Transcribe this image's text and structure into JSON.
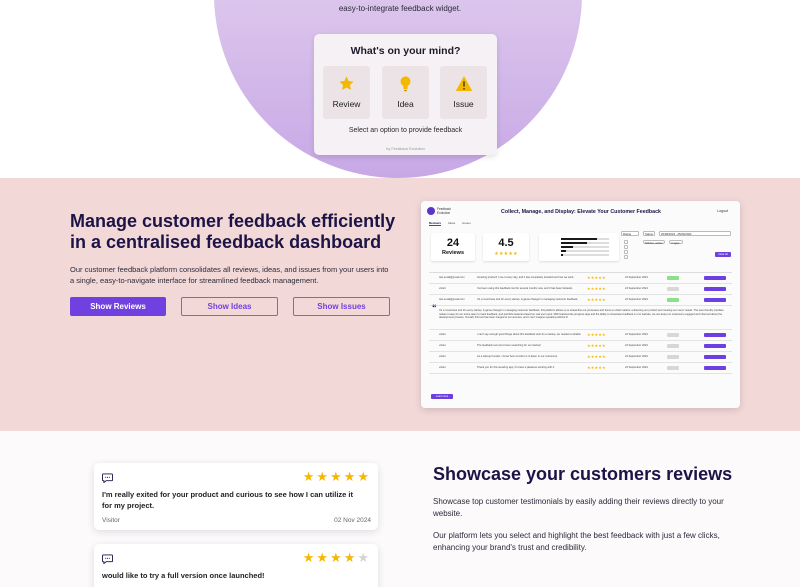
{
  "hero": {
    "subtitle": "easy-to-integrate feedback widget."
  },
  "widget": {
    "title": "What's on your mind?",
    "options": [
      {
        "label": "Review",
        "icon": "star-icon"
      },
      {
        "label": "Idea",
        "icon": "lightbulb-icon"
      },
      {
        "label": "Issue",
        "icon": "warning-icon"
      }
    ],
    "hint": "Select an option to provide feedback",
    "footer": "by Feedback Evolution"
  },
  "dashboard": {
    "heading": "Manage customer feedback efficiently in a centralised feedback dashboard",
    "paragraph": "Our customer feedback platform consolidates all reviews, ideas, and issues from your users into a single, easy-to-navigate interface for streamlined feedback management.",
    "buttons": [
      "Show Reviews",
      "Show Ideas",
      "Show Issues"
    ],
    "preview": {
      "brand": "Feedback Evolution",
      "title": "Collect, Manage, and Display: Elevate Your Customer Feedback",
      "logout": "Logout",
      "tabs": [
        "Reviews",
        "Ideas",
        "Issues"
      ],
      "total_reviews": "24",
      "reviews_label": "Reviews",
      "average_rating": "4.5",
      "average_stars": 4.5,
      "rating_distribution": [
        0.75,
        0.55,
        0.25,
        0.1,
        0.05
      ],
      "filters": {
        "rating": "Rating",
        "status": "Status",
        "date_range": "25/08/2023 - 25/09/2024",
        "chip1": "Hidden, active",
        "chip2": "4 ages"
      },
      "clear_label": "Clear all",
      "load_more": "Load more",
      "quote": "It's a must-have tool for every startup. A game-changer in managing customer feedback. this platform allows us to streamline our processes and focus on what matters: enhancing our product and meeting our users' needs. The user-friendly interface makes it easy for our entire team to track feedback, and prioritize features based on real user input. With features like progress tags and the ability to showcase feedback on our website, we can keep our customers engaged and informed about the development process. Overall, this tool has been integral to our success, and I can't imagine operating without it!",
      "rows": [
        {
          "user": "test.email@gmail.com",
          "text": "Amazing product! I use it every day, and it has completely transformed how we work.",
          "stars": 5,
          "date": "24 September 2024",
          "status": "Active"
        },
        {
          "user": "visitor",
          "text": "I've been using this feedback tool for several months now, and it has been fantastic.",
          "stars": 5,
          "date": "24 September 2024",
          "status": "Hidden"
        },
        {
          "user": "test.email@gmail.com",
          "text": "It's a must-have tool for every startup. A game-changer in managing customer feedback.",
          "stars": 5,
          "date": "24 September 2024",
          "status": "Active"
        },
        {
          "user": "visitor",
          "text": "I can't say enough good things about this feedback tool! As a startup, we needed a reliable way.",
          "stars": 5,
          "date": "24 September 2024",
          "status": "Hidden"
        },
        {
          "user": "visitor",
          "text": "The feedback tool we've been searching for our startup!",
          "stars": 5,
          "date": "24 September 2024",
          "status": "Hidden"
        },
        {
          "user": "visitor",
          "text": "As a startup founder, I know how crucial it is to listen to our customers.",
          "stars": 5,
          "date": "24 September 2024",
          "status": "Hidden"
        },
        {
          "user": "visitor",
          "text": "Thank you for this amazing app, it's been a pleasure working with it.",
          "stars": 5,
          "date": "23 September 2024",
          "status": "Archived"
        }
      ]
    }
  },
  "reviews": {
    "heading": "Showcase your customers reviews",
    "paragraph1": "Showcase top customer testimonials by easily adding their reviews directly to your website.",
    "paragraph2": "Our platform lets you select and highlight the best feedback with just a few clicks, enhancing your brand's trust and credibility.",
    "cards": [
      {
        "text": "I'm really exited for your product and curious to see how I can utilize it for my project.",
        "author": "Visitor",
        "date": "02 Nov 2024",
        "stars": 5
      },
      {
        "text": "would like to try a full version once launched!",
        "author": "",
        "date": "",
        "stars": 4
      }
    ]
  },
  "colors": {
    "accent": "#7040e0",
    "heading": "#1c1446",
    "dashboard_bg": "#f3d8d8",
    "star": "#f5b800",
    "hero_circle": "#d3b8ea"
  }
}
